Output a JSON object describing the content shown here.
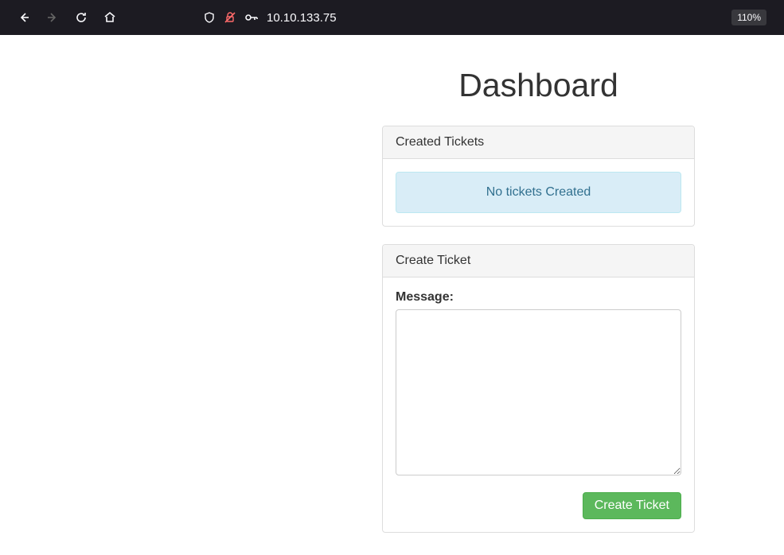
{
  "browser": {
    "url": "10.10.133.75",
    "zoom": "110%"
  },
  "page": {
    "title": "Dashboard"
  },
  "tickets_panel": {
    "header": "Created Tickets",
    "empty_message": "No tickets Created"
  },
  "create_panel": {
    "header": "Create Ticket",
    "message_label": "Message:",
    "textarea_value": "",
    "submit_label": "Create Ticket"
  }
}
